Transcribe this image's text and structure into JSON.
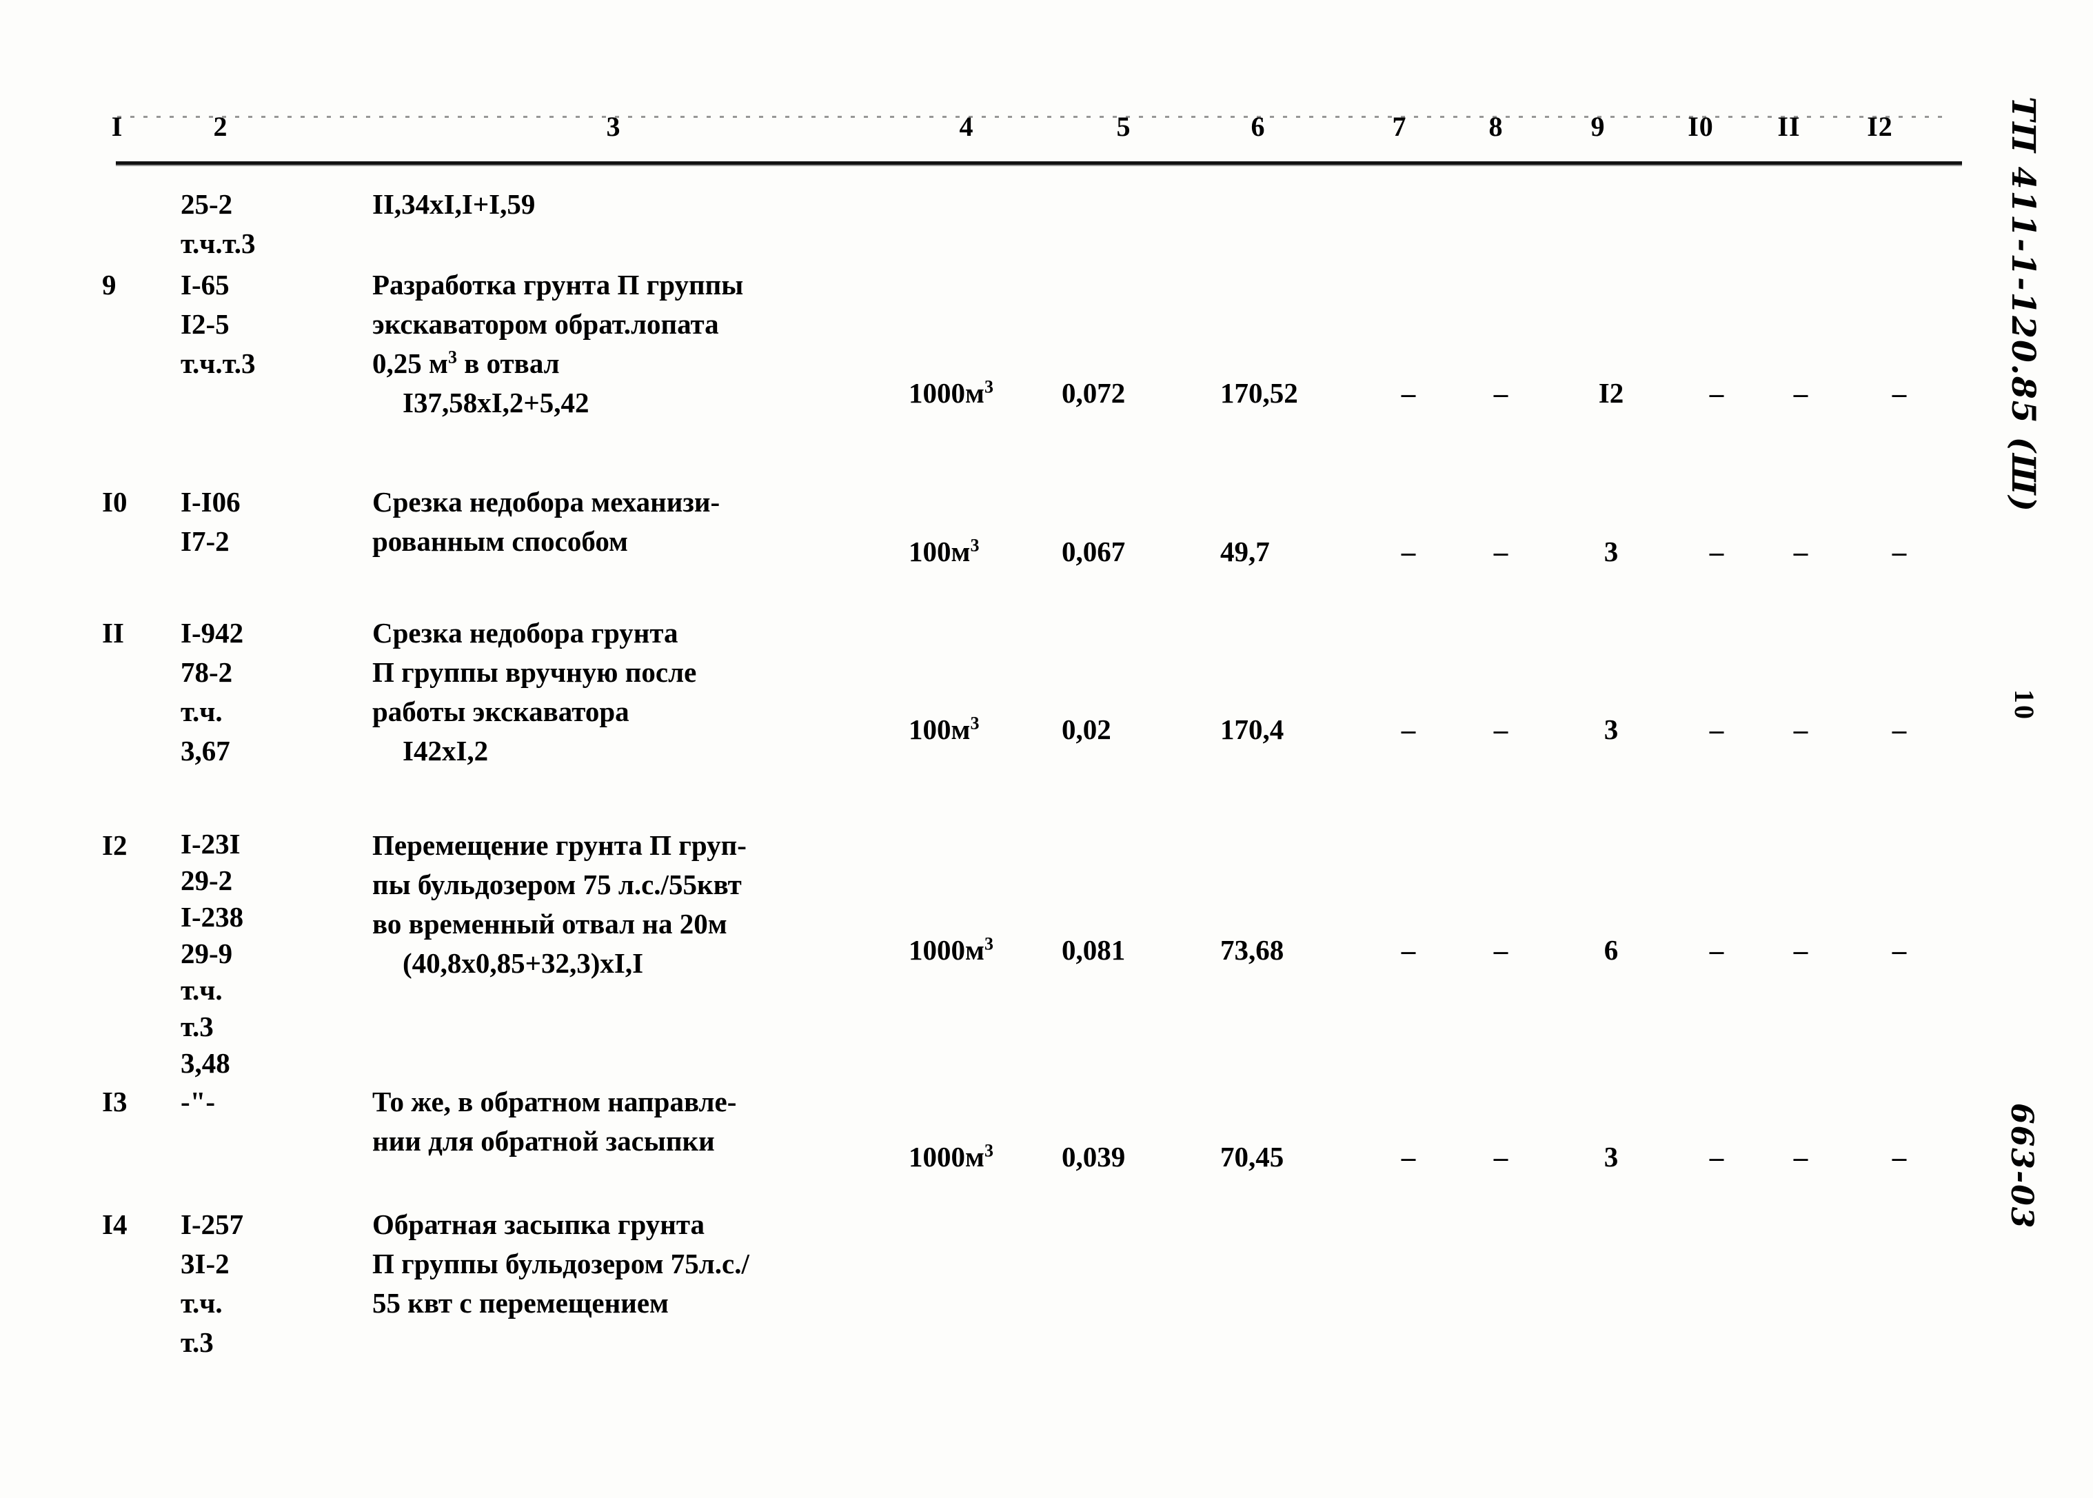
{
  "document": {
    "code_stamp": "ТП 411-1-120.85 (Ш)",
    "page_number": "10",
    "archive_code": "663-03"
  },
  "table": {
    "column_headers": [
      "I",
      "2",
      "3",
      "4",
      "5",
      "6",
      "7",
      "8",
      "9",
      "I0",
      "II",
      "I2"
    ],
    "rows": [
      {
        "no": "",
        "code_lines": [
          "25-2",
          "т.ч.т.3"
        ],
        "desc_lines": [
          "II,34xI,I+I,59"
        ],
        "desc_indents": [
          0
        ],
        "unit": "",
        "unit_sup": "",
        "quantity": "",
        "value": "",
        "c7": "",
        "c8": "",
        "c9": "",
        "c10": "",
        "c11": "",
        "c12": ""
      },
      {
        "no": "9",
        "code_lines": [
          "I-65",
          "I2-5",
          "т.ч.т.3"
        ],
        "desc_lines": [
          "Разработка грунта П группы",
          "экскаватором обрат.лопата",
          "0,25 м",
          "I37,58xI,2+5,42"
        ],
        "desc_indents": [
          0,
          0,
          0,
          1
        ],
        "desc_sup_line": 2,
        "desc_sup": "3",
        "desc_sup_tail": " в отвал",
        "unit": "1000м",
        "unit_sup": "3",
        "quantity": "0,072",
        "value": "170,52",
        "c7": "–",
        "c8": "–",
        "c9": "I2",
        "c10": "–",
        "c11": "–",
        "c12": "–"
      },
      {
        "no": "I0",
        "code_lines": [
          "I-I06",
          "I7-2"
        ],
        "desc_lines": [
          "Срезка недобора механизи-",
          "рованным способом"
        ],
        "desc_indents": [
          0,
          0
        ],
        "unit": "100м",
        "unit_sup": "3",
        "quantity": "0,067",
        "value": "49,7",
        "c7": "–",
        "c8": "–",
        "c9": "3",
        "c10": "–",
        "c11": "–",
        "c12": "–"
      },
      {
        "no": "II",
        "code_lines": [
          "I-942",
          "78-2",
          "т.ч.",
          "3,67"
        ],
        "desc_lines": [
          "Срезка недобора грунта",
          "П группы вручную после",
          "работы экскаватора",
          "I42xI,2"
        ],
        "desc_indents": [
          0,
          0,
          0,
          1
        ],
        "unit": "100м",
        "unit_sup": "3",
        "quantity": "0,02",
        "value": "170,4",
        "c7": "–",
        "c8": "–",
        "c9": "3",
        "c10": "–",
        "c11": "–",
        "c12": "–"
      },
      {
        "no": "I2",
        "code_lines": [
          "I-23I",
          "29-2",
          "I-238",
          "29-9",
          "т.ч.",
          "т.3",
          "3,48"
        ],
        "desc_lines": [
          "Перемещение грунта П груп-",
          "пы бульдозером 75 л.с./55квт",
          "во временный отвал на 20м",
          "(40,8x0,85+32,3)xI,I"
        ],
        "desc_indents": [
          0,
          0,
          0,
          1
        ],
        "unit": "1000м",
        "unit_sup": "3",
        "quantity": "0,081",
        "value": "73,68",
        "c7": "–",
        "c8": "–",
        "c9": "6",
        "c10": "–",
        "c11": "–",
        "c12": "–"
      },
      {
        "no": "I3",
        "code_lines": [
          "-\"-"
        ],
        "desc_lines": [
          "То же, в обратном направле-",
          "нии для обратной засыпки"
        ],
        "desc_indents": [
          0,
          0
        ],
        "unit": "1000м",
        "unit_sup": "3",
        "quantity": "0,039",
        "value": "70,45",
        "c7": "–",
        "c8": "–",
        "c9": "3",
        "c10": "–",
        "c11": "–",
        "c12": "–"
      },
      {
        "no": "I4",
        "code_lines": [
          "I-257",
          "3I-2",
          "т.ч.",
          "т.3"
        ],
        "desc_lines": [
          "Обратная засыпка грунта",
          "П группы бульдозером 75л.с./",
          "55 квт с перемещением"
        ],
        "desc_indents": [
          0,
          0,
          0
        ],
        "unit": "",
        "unit_sup": "",
        "quantity": "",
        "value": "",
        "c7": "",
        "c8": "",
        "c9": "",
        "c10": "",
        "c11": "",
        "c12": ""
      }
    ]
  }
}
